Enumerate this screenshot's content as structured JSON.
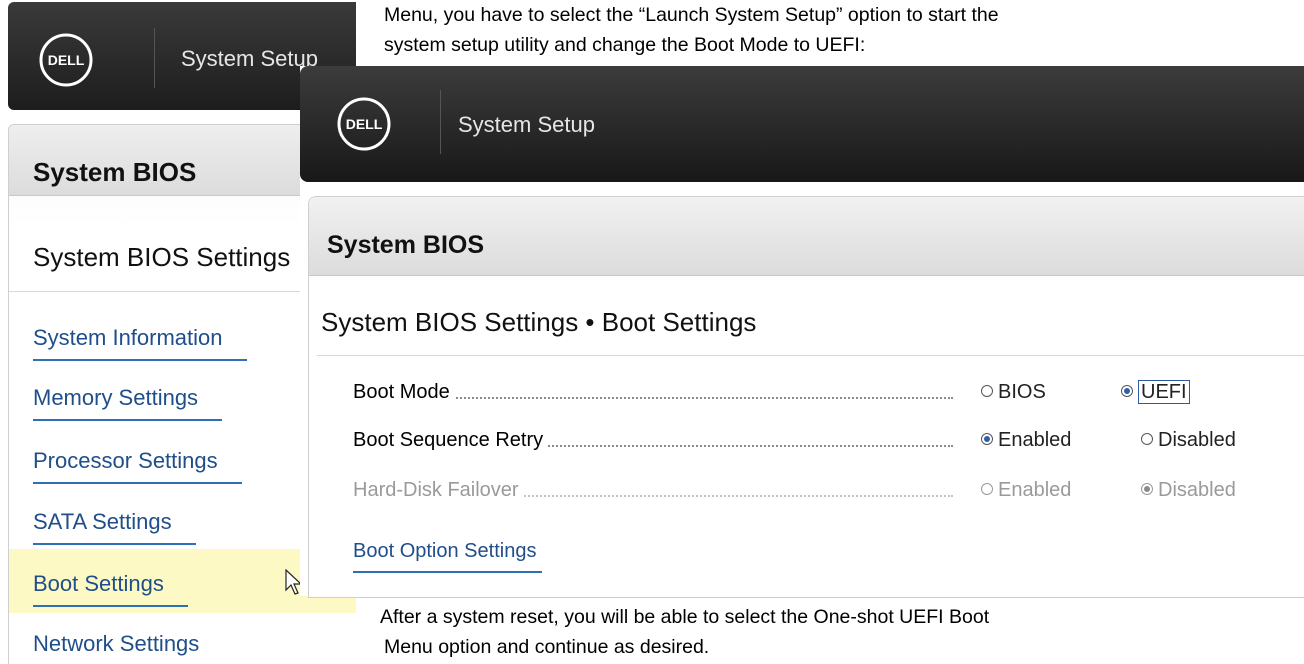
{
  "document": {
    "intro_line_1": "Menu, you have to select the “Launch System Setup” option to start the",
    "intro_line_2": "system setup utility and change the Boot Mode to UEFI:",
    "outro_line_1": " After a system reset, you will be able to select the One-shot UEFI Boot",
    "outro_line_2": "Menu option and continue as desired."
  },
  "back_window": {
    "logo_text": "DELL",
    "app_title": "System Setup",
    "section_title": "System BIOS",
    "page_title": "System BIOS Settings",
    "nav_items": [
      {
        "label": "System Information"
      },
      {
        "label": "Memory Settings"
      },
      {
        "label": "Processor Settings"
      },
      {
        "label": "SATA Settings"
      },
      {
        "label": "Boot Settings",
        "highlighted": true
      },
      {
        "label": "Network Settings"
      }
    ]
  },
  "front_window": {
    "logo_text": "DELL",
    "app_title": "System Setup",
    "section_title": "System BIOS",
    "page_title": "System BIOS Settings • Boot Settings",
    "settings": [
      {
        "label": "Boot Mode",
        "options": [
          "BIOS",
          "UEFI"
        ],
        "selected": "UEFI",
        "enabled": true
      },
      {
        "label": "Boot Sequence Retry",
        "options": [
          "Enabled",
          "Disabled"
        ],
        "selected": "Enabled",
        "enabled": true
      },
      {
        "label": "Hard-Disk Failover",
        "options": [
          "Enabled",
          "Disabled"
        ],
        "selected": "Disabled",
        "enabled": false
      }
    ],
    "link": "Boot Option Settings"
  },
  "colors": {
    "link": "#1f4e8a",
    "radio_selected": "#2d5fa8",
    "highlight": "#fdf9c4",
    "title_bar": "#1d1d1d"
  }
}
